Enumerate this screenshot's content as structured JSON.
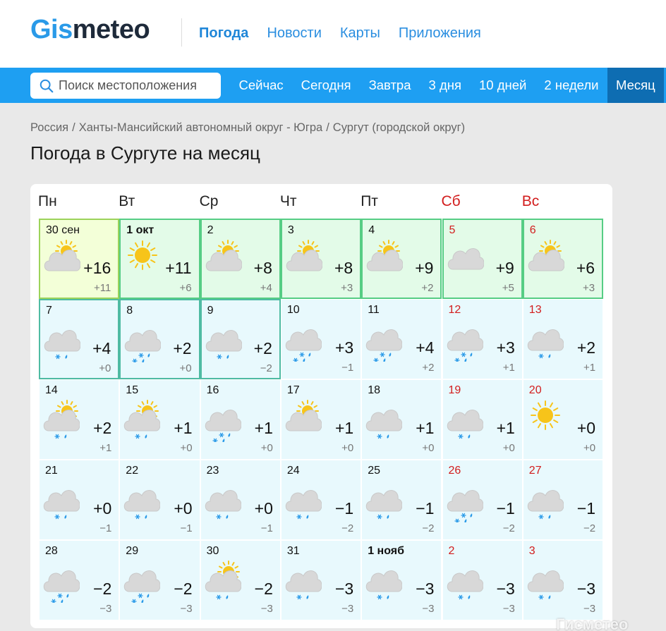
{
  "header": {
    "logo_part1": "Gis",
    "logo_part2": "meteo",
    "nav": [
      "Погода",
      "Новости",
      "Карты",
      "Приложения"
    ],
    "active_nav": 0
  },
  "search": {
    "placeholder": "Поиск местоположения"
  },
  "subnav": {
    "items": [
      "Сейчас",
      "Сегодня",
      "Завтра",
      "3 дня",
      "10 дней",
      "2 недели",
      "Месяц"
    ],
    "active": 6
  },
  "breadcrumb": [
    "Россия",
    "Ханты-Мансийский автономный округ - Югра",
    "Сургут (городской округ)"
  ],
  "page_title": "Погода в Сургуте на месяц",
  "weekdays": [
    {
      "label": "Пн",
      "weekend": false
    },
    {
      "label": "Вт",
      "weekend": false
    },
    {
      "label": "Ср",
      "weekend": false
    },
    {
      "label": "Чт",
      "weekend": false
    },
    {
      "label": "Пт",
      "weekend": false
    },
    {
      "label": "Сб",
      "weekend": true
    },
    {
      "label": "Вс",
      "weekend": true
    }
  ],
  "days": [
    {
      "date": "30 сен",
      "max": "+16",
      "min": "+11",
      "icon": "partly-cloudy",
      "bg": "today",
      "hl": "today"
    },
    {
      "date": "1 окт",
      "max": "+11",
      "min": "+6",
      "icon": "sun",
      "bg": "green",
      "hl": "green",
      "bold": true
    },
    {
      "date": "2",
      "max": "+8",
      "min": "+4",
      "icon": "partly-cloudy",
      "bg": "green",
      "hl": "green"
    },
    {
      "date": "3",
      "max": "+8",
      "min": "+3",
      "icon": "partly-cloudy",
      "bg": "green",
      "hl": "green"
    },
    {
      "date": "4",
      "max": "+9",
      "min": "+2",
      "icon": "partly-cloudy",
      "bg": "green",
      "hl": "green"
    },
    {
      "date": "5",
      "max": "+9",
      "min": "+5",
      "icon": "cloudy",
      "bg": "green",
      "hl": "green",
      "weekend": true
    },
    {
      "date": "6",
      "max": "+6",
      "min": "+3",
      "icon": "partly-cloudy",
      "bg": "green",
      "hl": "green",
      "weekend": true
    },
    {
      "date": "7",
      "max": "+4",
      "min": "+0",
      "icon": "cloud-sleet-light",
      "bg": "blue",
      "hl": "teal"
    },
    {
      "date": "8",
      "max": "+2",
      "min": "+0",
      "icon": "cloud-sleet",
      "bg": "blue",
      "hl": "teal"
    },
    {
      "date": "9",
      "max": "+2",
      "min": "−2",
      "icon": "cloud-sleet-light",
      "bg": "blue",
      "hl": "teal"
    },
    {
      "date": "10",
      "max": "+3",
      "min": "−1",
      "icon": "cloud-sleet",
      "bg": "blue",
      "hl": ""
    },
    {
      "date": "11",
      "max": "+4",
      "min": "+2",
      "icon": "cloud-sleet",
      "bg": "blue",
      "hl": ""
    },
    {
      "date": "12",
      "max": "+3",
      "min": "+1",
      "icon": "cloud-sleet",
      "bg": "blue",
      "hl": "",
      "weekend": true
    },
    {
      "date": "13",
      "max": "+2",
      "min": "+1",
      "icon": "cloud-sleet-light",
      "bg": "blue",
      "hl": "",
      "weekend": true
    },
    {
      "date": "14",
      "max": "+2",
      "min": "+1",
      "icon": "sun-cloud-sleet",
      "bg": "blue",
      "hl": ""
    },
    {
      "date": "15",
      "max": "+1",
      "min": "+0",
      "icon": "sun-cloud-sleet",
      "bg": "blue",
      "hl": ""
    },
    {
      "date": "16",
      "max": "+1",
      "min": "+0",
      "icon": "cloud-sleet",
      "bg": "blue",
      "hl": ""
    },
    {
      "date": "17",
      "max": "+1",
      "min": "+0",
      "icon": "partly-cloudy",
      "bg": "blue",
      "hl": ""
    },
    {
      "date": "18",
      "max": "+1",
      "min": "+0",
      "icon": "cloud-sleet-light",
      "bg": "blue",
      "hl": ""
    },
    {
      "date": "19",
      "max": "+1",
      "min": "+0",
      "icon": "cloud-sleet-light",
      "bg": "blue",
      "hl": "",
      "weekend": true
    },
    {
      "date": "20",
      "max": "+0",
      "min": "+0",
      "icon": "sun",
      "bg": "blue",
      "hl": "",
      "weekend": true
    },
    {
      "date": "21",
      "max": "+0",
      "min": "−1",
      "icon": "cloud-sleet-light",
      "bg": "blue",
      "hl": ""
    },
    {
      "date": "22",
      "max": "+0",
      "min": "−1",
      "icon": "cloud-sleet-light",
      "bg": "blue",
      "hl": ""
    },
    {
      "date": "23",
      "max": "+0",
      "min": "−1",
      "icon": "cloud-sleet-light",
      "bg": "blue",
      "hl": ""
    },
    {
      "date": "24",
      "max": "−1",
      "min": "−2",
      "icon": "cloud-sleet-light",
      "bg": "blue",
      "hl": ""
    },
    {
      "date": "25",
      "max": "−1",
      "min": "−2",
      "icon": "cloud-sleet-light",
      "bg": "blue",
      "hl": ""
    },
    {
      "date": "26",
      "max": "−1",
      "min": "−2",
      "icon": "cloud-sleet",
      "bg": "blue",
      "hl": "",
      "weekend": true
    },
    {
      "date": "27",
      "max": "−1",
      "min": "−2",
      "icon": "cloud-sleet-light",
      "bg": "blue",
      "hl": "",
      "weekend": true
    },
    {
      "date": "28",
      "max": "−2",
      "min": "−3",
      "icon": "cloud-sleet",
      "bg": "blue",
      "hl": ""
    },
    {
      "date": "29",
      "max": "−2",
      "min": "−3",
      "icon": "cloud-sleet",
      "bg": "blue",
      "hl": ""
    },
    {
      "date": "30",
      "max": "−2",
      "min": "−3",
      "icon": "sun-cloud-sleet",
      "bg": "blue",
      "hl": ""
    },
    {
      "date": "31",
      "max": "−3",
      "min": "−3",
      "icon": "cloud-sleet-light",
      "bg": "blue",
      "hl": ""
    },
    {
      "date": "1 нояб",
      "max": "−3",
      "min": "−3",
      "icon": "cloud-sleet-light",
      "bg": "blue",
      "hl": "",
      "bold": true
    },
    {
      "date": "2",
      "max": "−3",
      "min": "−3",
      "icon": "cloud-sleet-light",
      "bg": "blue",
      "hl": "",
      "weekend": true
    },
    {
      "date": "3",
      "max": "−3",
      "min": "−3",
      "icon": "cloud-sleet-light",
      "bg": "blue",
      "hl": "",
      "weekend": true
    }
  ],
  "watermark": "Гисметео",
  "colors": {
    "brand_blue": "#1e9ff2",
    "active_tab": "#0e6db2",
    "weekend_red": "#d21d1d",
    "cell_blue": "#e8f9fd",
    "cell_green": "#e3fbe8",
    "cell_today": "#f3ffd8",
    "sun": "#f7c41a"
  }
}
